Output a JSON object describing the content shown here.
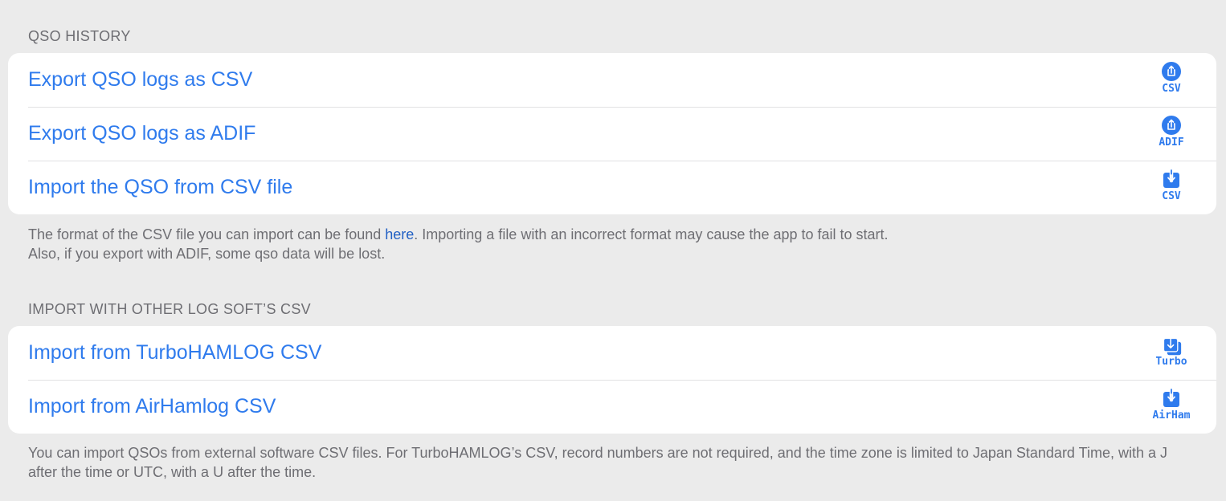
{
  "qso_history": {
    "header": "QSO HISTORY",
    "rows": [
      {
        "label": "Export QSO logs as CSV",
        "icon": "share-icon",
        "caption": "CSV"
      },
      {
        "label": "Export QSO logs as ADIF",
        "icon": "share-icon",
        "caption": "ADIF"
      },
      {
        "label": "Import the QSO from CSV file",
        "icon": "download-icon",
        "caption": "CSV"
      }
    ],
    "footer_part1": "The format of the CSV file you can import can be found ",
    "footer_link": "here",
    "footer_part2": ". Importing a file with an incorrect format may cause the app to fail to start.",
    "footer_line2": "Also, if you export with ADIF, some qso data will be lost."
  },
  "other_log_soft": {
    "header": "IMPORT WITH OTHER LOG SOFT’S CSV",
    "rows": [
      {
        "label": "Import from TurboHAMLOG CSV",
        "icon": "download-stack-icon",
        "caption": "Turbo"
      },
      {
        "label": "Import from AirHamlog CSV",
        "icon": "download-icon",
        "caption": "AirHam"
      }
    ],
    "footer": "You can import QSOs from external software CSV files. For TurboHAMLOG’s CSV, record numbers are not required, and the time zone is limited to Japan Standard Time, with a J after the time or UTC, with a U after the time."
  },
  "colors": {
    "background": "#ebebeb",
    "accent": "#2f7bed",
    "secondary_text": "#6e6e73"
  }
}
